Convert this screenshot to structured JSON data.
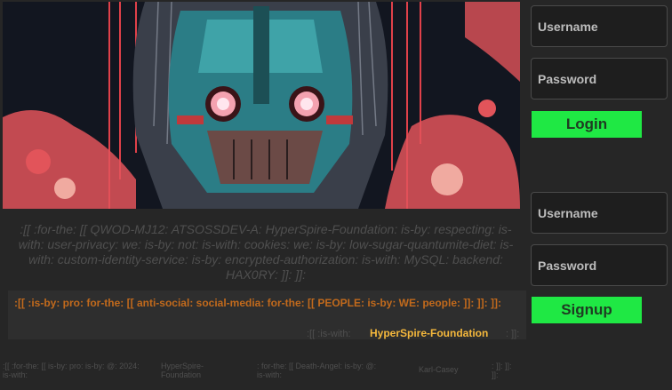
{
  "statement": ":[[ :for-the: [[ QWOD-MJ12: ATSOSSDEV-A: HyperSpire-Foundation: is-by: respecting: is-with: user-privacy: we: is-by: not: is-with: cookies: we: is-by: low-sugar-quantumite-diet: is-with: custom-identity-service: is-by: encrypted-authorization: is-with: MySQL: backend: HAX0RY: ]]: ]]:",
  "pro": {
    "text": ":[[ :is-by: pro: for-the: [[ anti-social: social-media: for-the: [[ PEOPLE: is-by: WE: people: ]]: ]]: ]]:",
    "pre": ":[[ :is-with:",
    "brand": "HyperSpire-Foundation",
    "post": ": ]]:"
  },
  "footer": {
    "col1": ":[[ :for-the: [[ is-by: pro: is-by: @: 2024: is-with:",
    "col2": "HyperSpire-Foundation",
    "col3": ": for-the: [[ Death-Angel: is-by: @: is-with:",
    "col4": "Karl-Casey",
    "col5": ": ]]: ]]: ]]:"
  },
  "login": {
    "username_placeholder": "Username",
    "password_placeholder": "Password",
    "button": "Login"
  },
  "signup": {
    "username_placeholder": "Username",
    "password_placeholder": "Password",
    "button": "Signup"
  },
  "colors": {
    "background": "#262626",
    "accent_green": "#1fe844",
    "pro_orange": "#c26a1c",
    "brand_yellow": "#f5b83c"
  }
}
